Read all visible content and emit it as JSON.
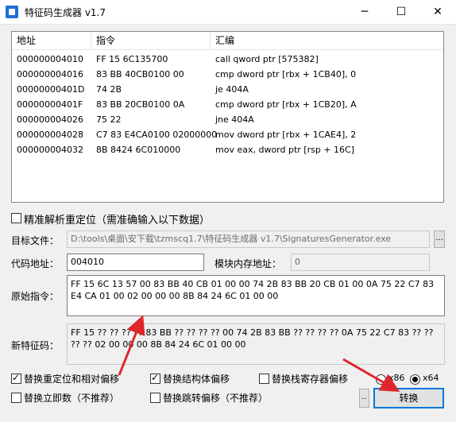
{
  "window": {
    "title": "特征码生成器 v1.7",
    "minimize_icon": "─",
    "maximize_icon": "☐",
    "close_icon": "✕"
  },
  "table": {
    "headers": [
      "地址",
      "指令",
      "汇编"
    ],
    "rows": [
      [
        "000000004010",
        "FF 15 6C135700",
        "call qword ptr [575382]"
      ],
      [
        "000000004016",
        "83 BB 40CB0100 00",
        "cmp dword ptr [rbx + 1CB40], 0"
      ],
      [
        "00000000401D",
        "74 2B",
        "je 404A"
      ],
      [
        "00000000401F",
        "83 BB 20CB0100 0A",
        "cmp dword ptr [rbx + 1CB20], A"
      ],
      [
        "000000004026",
        "75 22",
        "jne 404A"
      ],
      [
        "000000004028",
        "C7 83 E4CA0100 02000000",
        "mov dword ptr [rbx + 1CAE4], 2"
      ],
      [
        "000000004032",
        "8B 8424 6C010000",
        "mov eax, dword ptr [rsp + 16C]"
      ]
    ]
  },
  "precise": {
    "label": "精准解析重定位（需准确输入以下数据）",
    "checked": false
  },
  "target_file": {
    "label": "目标文件：",
    "value": "D:\\tools\\桌面\\安下载\\tzmscq1.7\\特征码生成器 v1.7\\SignaturesGenerator.exe",
    "browse_label": "..."
  },
  "code_address": {
    "label": "代码地址：",
    "value": "004010"
  },
  "module_base": {
    "label": "模块内存地址：",
    "value": "0"
  },
  "original": {
    "label": "原始指令：",
    "value": "FF 15 6C 13 57 00 83 BB 40 CB 01 00 00 74 2B 83 BB 20 CB 01 00 0A 75 22 C7 83 E4 CA 01 00 02 00 00 00 8B 84 24 6C 01 00 00"
  },
  "new_sig": {
    "label": "新特征码：",
    "value": "FF 15 ?? ?? ?? ?? 83 BB ?? ?? ?? ?? 00 74 2B 83 BB ?? ?? ?? ?? 0A 75 22 C7 83 ?? ?? ?? ?? 02 00 00 00 8B 84 24 6C 01 00 00"
  },
  "options": {
    "reloc": {
      "label": "替换重定位和相对偏移",
      "checked": true
    },
    "struct": {
      "label": "替换结构体偏移",
      "checked": true
    },
    "stack": {
      "label": "替换栈寄存器偏移",
      "checked": false
    },
    "imm": {
      "label": "替换立即数（不推荐）",
      "checked": false
    },
    "jump": {
      "label": "替换跳转偏移（不推荐）",
      "checked": false
    }
  },
  "arch": {
    "x86": "x86",
    "x64": "x64",
    "selected": "x64"
  },
  "small_button": "..",
  "convert_button": "转换",
  "colors": {
    "accent": "#0078d7",
    "arrow": "#e0262b"
  }
}
